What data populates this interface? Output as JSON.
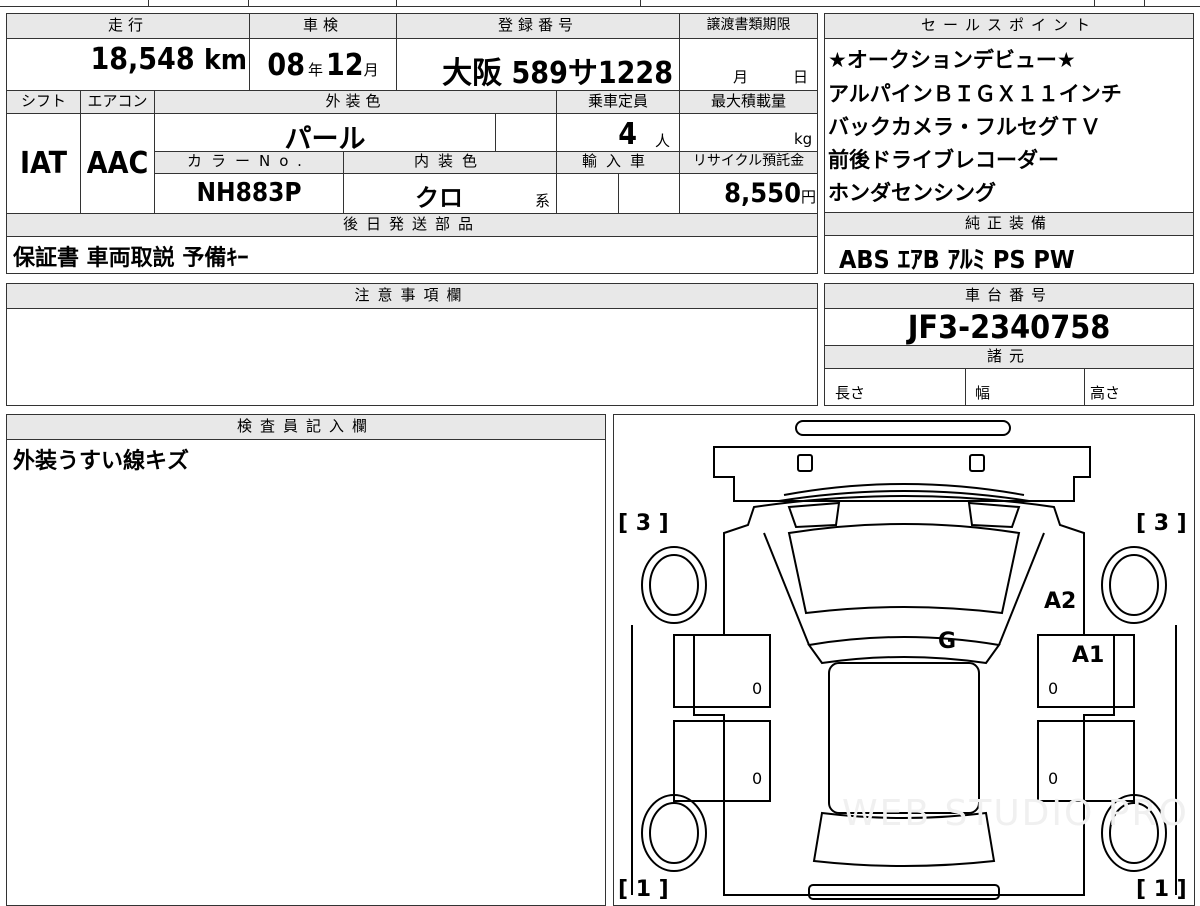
{
  "vehicle": {
    "mileage": "18,548",
    "mileage_unit": "km",
    "inspection_year": "08",
    "inspection_year_unit": "年",
    "inspection_month": "12",
    "inspection_month_unit": "月",
    "plate": "大阪 589サ1228",
    "transfer_month": "月",
    "transfer_day": "日",
    "shift": "IAT",
    "aircon": "AAC",
    "exterior_color": "パール",
    "capacity": "4",
    "capacity_unit": "人",
    "max_load_unit": "kg",
    "color_no": "NH883P",
    "interior_color": "クロ",
    "interior_suffix": "系",
    "recycle_fee": "8,550",
    "recycle_unit": "円",
    "later_parts": "保証書 車両取説 予備ｷｰ",
    "chassis_no": "JF3-2340758"
  },
  "headers": {
    "mileage": "走行",
    "inspection": "車検",
    "plate": "登録番号",
    "transfer_deadline": "譲渡書類期限",
    "sales_points": "セールスポイント",
    "shift": "シフト",
    "aircon": "エアコン",
    "exterior_color": "外装色",
    "capacity": "乗車定員",
    "max_load": "最大積載量",
    "color_no": "カラーNo.",
    "interior_color": "内装色",
    "import": "輸入車",
    "recycle": "リサイクル預託金",
    "later_parts": "後日発送部品",
    "equipment": "純正装備",
    "notes": "注意事項欄",
    "chassis": "車台番号",
    "specs": "諸元",
    "inspector": "検査員記入欄"
  },
  "sales_points": [
    "★オークションデビュー★",
    "アルパインＢＩＧＸ１１インチ",
    "バックカメラ・フルセグＴＶ",
    "前後ドライブレコーダー",
    "ホンダセンシング"
  ],
  "equipment": "ABS ｴｱB ｱﾙﾐ PS PW",
  "specs": {
    "length": "長さ",
    "width": "幅",
    "height": "高さ"
  },
  "inspector_note": "外装うすい線キズ",
  "diagram": {
    "front_left": "[ 3 ]",
    "front_right": "[ 3 ]",
    "rear_left": "[ 1 ]",
    "rear_right": "[ 1 ]",
    "mark_a2": "A2",
    "mark_a1": "A1",
    "mark_g": "G",
    "door_fl": "0",
    "door_rl": "0",
    "door_fr": "0",
    "door_rr": "0"
  },
  "watermark": "WEB STUDIO PRO"
}
